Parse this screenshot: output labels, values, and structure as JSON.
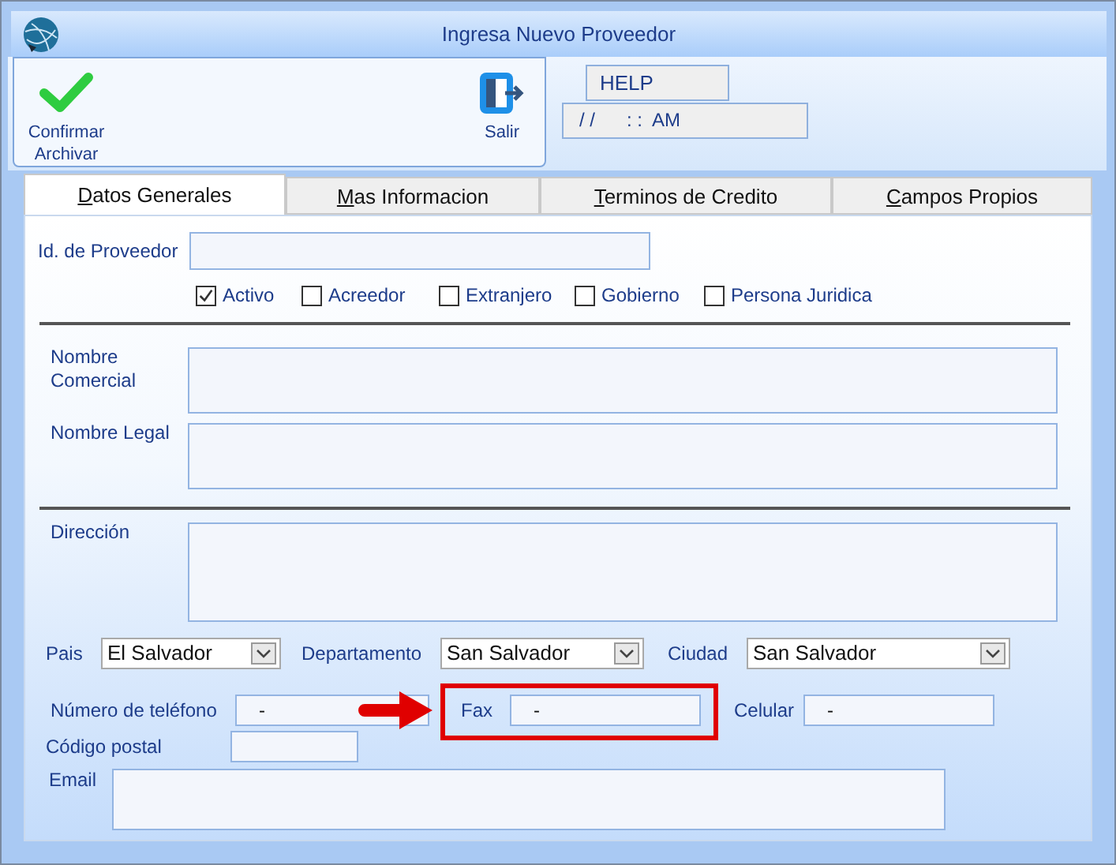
{
  "window": {
    "title": "Ingresa Nuevo Proveedor"
  },
  "toolbar": {
    "confirm": "Confirmar Archivar",
    "exit": "Salir"
  },
  "session": {
    "user": "HELP",
    "datetime": "/ /      : :  AM"
  },
  "tabs": [
    {
      "label": "Datos Generales",
      "selected": true
    },
    {
      "label": "Mas Informacion",
      "selected": false
    },
    {
      "label": "Terminos de Credito",
      "selected": false
    },
    {
      "label": "Campos Propios",
      "selected": false
    }
  ],
  "id_field": {
    "label": "Id. de Proveedor"
  },
  "flags": [
    {
      "label": "Activo",
      "checked": true
    },
    {
      "label": "Acreedor",
      "checked": false
    },
    {
      "label": "Extranjero",
      "checked": false
    },
    {
      "label": "Gobierno",
      "checked": false
    },
    {
      "label": "Persona Juridica",
      "checked": false
    }
  ],
  "names": [
    {
      "label": "Nombre Comercial"
    },
    {
      "label": "Nombre Legal"
    }
  ],
  "address": {
    "label": "Dirección"
  },
  "location": [
    {
      "label": "Pais",
      "value": "El Salvador"
    },
    {
      "label": "Departamento",
      "value": "San Salvador"
    },
    {
      "label": "Ciudad",
      "value": "San Salvador"
    }
  ],
  "phones": [
    {
      "label": "Número de teléfono",
      "value": "-",
      "highlighted": false
    },
    {
      "label": "Fax",
      "value": "-",
      "highlighted": true
    },
    {
      "label": "Celular",
      "value": "-",
      "highlighted": false
    }
  ],
  "postal": {
    "label": "Código postal"
  },
  "email": {
    "label": "Email"
  }
}
